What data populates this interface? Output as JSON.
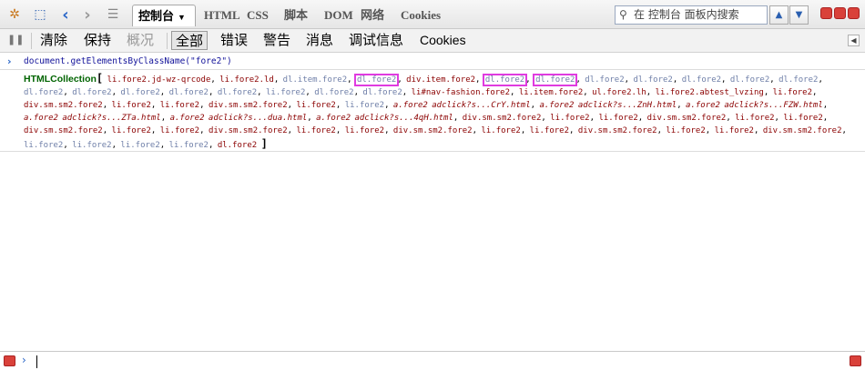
{
  "toolbar": {
    "tabs": [
      {
        "label": "控制台"
      },
      {
        "label": "HTML"
      },
      {
        "label": "CSS"
      },
      {
        "label": "脚本"
      },
      {
        "label": "DOM"
      },
      {
        "label": "网络"
      },
      {
        "label": "Cookies"
      }
    ],
    "search_placeholder": "在 控制台 面板内搜索",
    "icons": [
      "firebug-bug-icon",
      "inspect-icon",
      "back-icon",
      "forward-icon",
      "menu-icon",
      "search-icon",
      "search-up-icon",
      "search-down-icon",
      "minimize-icon",
      "restore-icon",
      "close-icon"
    ]
  },
  "subtoolbar": {
    "items": [
      {
        "label": "清除"
      },
      {
        "label": "保持"
      },
      {
        "label": "概况"
      },
      {
        "label": "全部"
      },
      {
        "label": "错误"
      },
      {
        "label": "警告"
      },
      {
        "label": "消息"
      },
      {
        "label": "调试信息"
      },
      {
        "label": "Cookies"
      }
    ]
  },
  "console": {
    "command": "document.getElementsByClassName(\"fore2\")",
    "result_type": "HTMLCollection",
    "open_bracket": "[",
    "close_bracket": "]",
    "items": [
      {
        "text": "li.fore2.jd-wz-qrcode",
        "style": "normal"
      },
      {
        "text": "li.fore2.ld",
        "style": "normal"
      },
      {
        "text": "dl.item.fore2",
        "style": "dim"
      },
      {
        "text": "dl.fore2",
        "style": "boxed"
      },
      {
        "text": "div.item.fore2",
        "style": "normal"
      },
      {
        "text": "dl.fore2",
        "style": "boxed"
      },
      {
        "text": "dl.fore2",
        "style": "boxed"
      },
      {
        "text": "dl.fore2",
        "style": "dim"
      },
      {
        "text": "dl.fore2",
        "style": "dim"
      },
      {
        "text": "dl.fore2",
        "style": "dim"
      },
      {
        "text": "dl.fore2",
        "style": "dim"
      },
      {
        "text": "dl.fore2",
        "style": "dim"
      },
      {
        "text": "dl.fore2",
        "style": "dim"
      },
      {
        "text": "dl.fore2",
        "style": "dim"
      },
      {
        "text": "dl.fore2",
        "style": "dim"
      },
      {
        "text": "dl.fore2",
        "style": "dim"
      },
      {
        "text": "dl.fore2",
        "style": "dim"
      },
      {
        "text": "li.fore2",
        "style": "dim"
      },
      {
        "text": "dl.fore2",
        "style": "dim"
      },
      {
        "text": "dl.fore2",
        "style": "dim"
      },
      {
        "text": "li#nav-fashion.fore2",
        "style": "normal"
      },
      {
        "text": "li.item.fore2",
        "style": "normal"
      },
      {
        "text": "ul.fore2.lh",
        "style": "normal"
      },
      {
        "text": "li.fore2.abtest_lvzing",
        "style": "normal"
      },
      {
        "text": "li.fore2",
        "style": "normal"
      },
      {
        "text": "div.sm.sm2.fore2",
        "style": "normal"
      },
      {
        "text": "li.fore2",
        "style": "normal"
      },
      {
        "text": "li.fore2",
        "style": "normal"
      },
      {
        "text": "div.sm.sm2.fore2",
        "style": "normal"
      },
      {
        "text": "li.fore2",
        "style": "normal"
      },
      {
        "text": "li.fore2",
        "style": "dim"
      },
      {
        "text": "a.fore2 adclick?s...CrY.html",
        "style": "italic"
      },
      {
        "text": "a.fore2 adclick?s...ZnH.html",
        "style": "italic"
      },
      {
        "text": "a.fore2 adclick?s...FZW.html",
        "style": "italic"
      },
      {
        "text": "a.fore2 adclick?s...ZTa.html",
        "style": "italic"
      },
      {
        "text": "a.fore2 adclick?s...dua.html",
        "style": "italic"
      },
      {
        "text": "a.fore2 adclick?s...4qH.html",
        "style": "italic"
      },
      {
        "text": "div.sm.sm2.fore2",
        "style": "normal"
      },
      {
        "text": "li.fore2",
        "style": "normal"
      },
      {
        "text": "li.fore2",
        "style": "normal"
      },
      {
        "text": "div.sm.sm2.fore2",
        "style": "normal"
      },
      {
        "text": "li.fore2",
        "style": "normal"
      },
      {
        "text": "li.fore2",
        "style": "normal"
      },
      {
        "text": "div.sm.sm2.fore2",
        "style": "normal"
      },
      {
        "text": "li.fore2",
        "style": "normal"
      },
      {
        "text": "li.fore2",
        "style": "normal"
      },
      {
        "text": "div.sm.sm2.fore2",
        "style": "normal"
      },
      {
        "text": "li.fore2",
        "style": "normal"
      },
      {
        "text": "li.fore2",
        "style": "normal"
      },
      {
        "text": "div.sm.sm2.fore2",
        "style": "normal"
      },
      {
        "text": "li.fore2",
        "style": "normal"
      },
      {
        "text": "li.fore2",
        "style": "normal"
      },
      {
        "text": "div.sm.sm2.fore2",
        "style": "normal"
      },
      {
        "text": "li.fore2",
        "style": "normal"
      },
      {
        "text": "li.fore2",
        "style": "normal"
      },
      {
        "text": "div.sm.sm2.fore2",
        "style": "normal"
      },
      {
        "text": "li.fore2",
        "style": "dim"
      },
      {
        "text": "li.fore2",
        "style": "dim"
      },
      {
        "text": "li.fore2",
        "style": "dim"
      },
      {
        "text": "li.fore2",
        "style": "dim"
      },
      {
        "text": "dl.fore2",
        "style": "normal"
      }
    ]
  },
  "colors": {
    "item_normal": "#8b0000",
    "item_dim": "#6f7fa8",
    "highlight_box": "#e03be0",
    "collection_label": "#006400"
  }
}
